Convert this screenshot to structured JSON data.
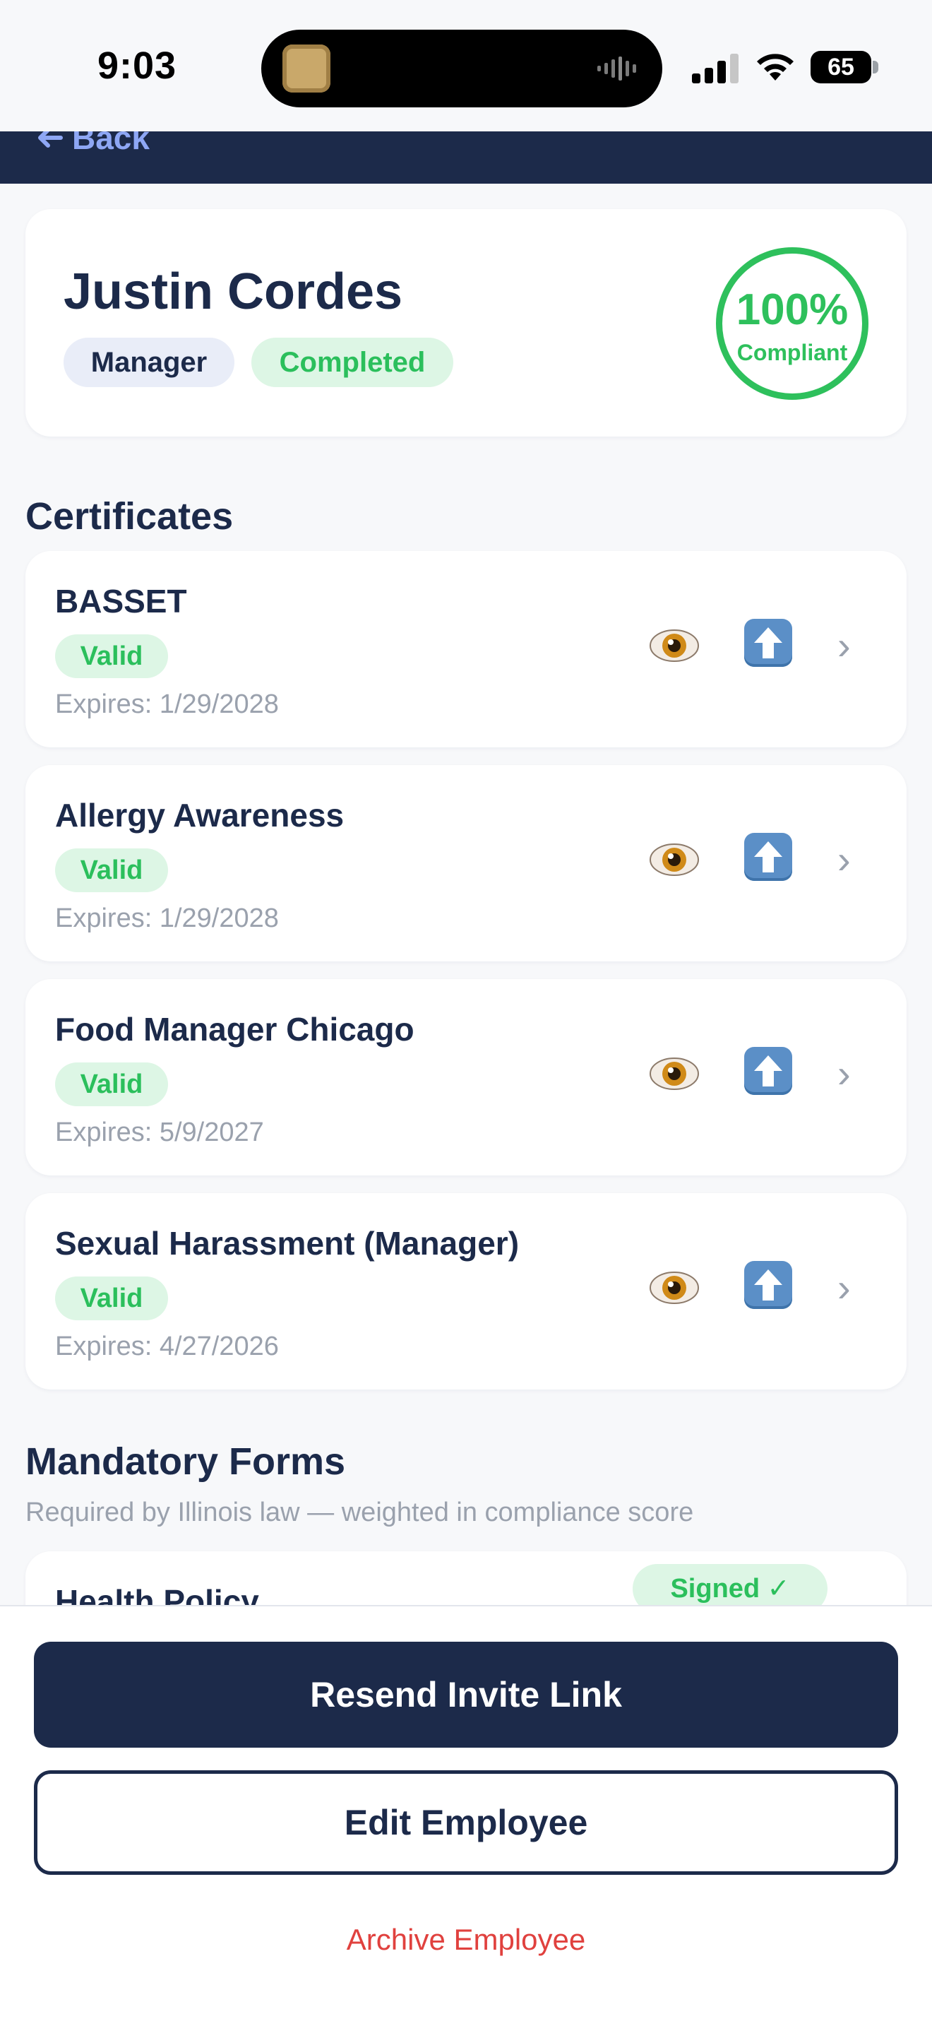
{
  "status_bar": {
    "time": "9:03",
    "battery": "65"
  },
  "header": {
    "back_label": "Back",
    "back_icon": "arrow-left-icon"
  },
  "employee": {
    "name": "Justin Cordes",
    "role": "Manager",
    "status": "Completed",
    "compliance_percent": "100%",
    "compliance_label": "Compliant"
  },
  "certificates": {
    "title": "Certificates",
    "items": [
      {
        "name": "BASSET",
        "status": "Valid",
        "expires": "Expires: 1/29/2028"
      },
      {
        "name": "Allergy Awareness",
        "status": "Valid",
        "expires": "Expires: 1/29/2028"
      },
      {
        "name": "Food Manager Chicago",
        "status": "Valid",
        "expires": "Expires: 5/9/2027"
      },
      {
        "name": "Sexual Harassment (Manager)",
        "status": "Valid",
        "expires": "Expires: 4/27/2026"
      }
    ]
  },
  "mandatory_forms": {
    "title": "Mandatory Forms",
    "subtitle": "Required by Illinois law — weighted in compliance score",
    "items": [
      {
        "name": "Health Policy",
        "status": "Signed ✓"
      }
    ]
  },
  "actions": {
    "resend_label": "Resend Invite Link",
    "edit_label": "Edit Employee",
    "archive_label": "Archive Employee"
  },
  "colors": {
    "navy": "#1c2a4a",
    "success": "#2ec05c",
    "danger": "#e0413e",
    "background": "#f7f8fa"
  }
}
